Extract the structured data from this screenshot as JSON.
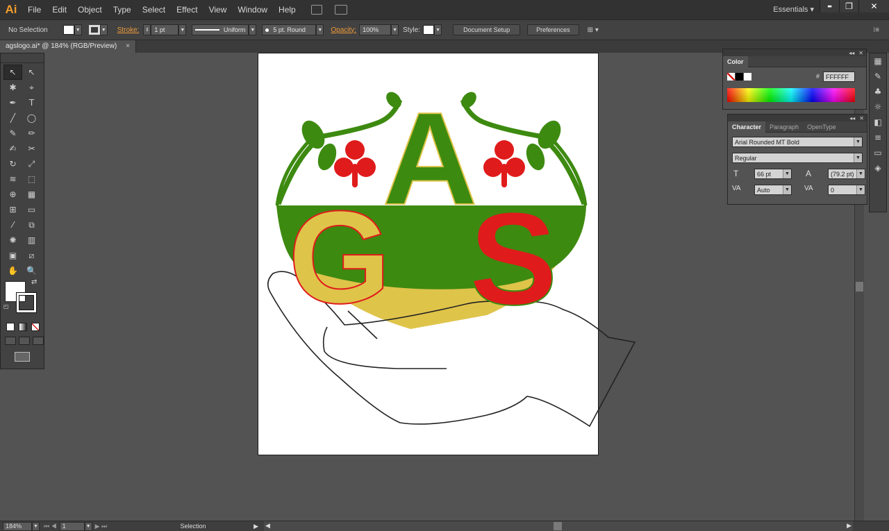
{
  "app": {
    "logo": "Ai"
  },
  "menu": [
    "File",
    "Edit",
    "Object",
    "Type",
    "Select",
    "Effect",
    "View",
    "Window",
    "Help"
  ],
  "workspace": "Essentials",
  "window_controls": {
    "minimize": "▬",
    "restore": "❐",
    "close": "✕"
  },
  "control_bar": {
    "selection": "No Selection",
    "stroke_label": "Stroke:",
    "stroke_value": "1 pt",
    "profile": "Uniform",
    "brush": "5 pt. Round",
    "opacity_label": "Opacity:",
    "opacity_value": "100%",
    "style_label": "Style:",
    "document_setup": "Document Setup",
    "preferences": "Preferences"
  },
  "document_tab": {
    "title": "agslogo.ai* @ 184% (RGB/Preview)",
    "close": "×"
  },
  "toolbox": {
    "tools": [
      [
        "selection-tool",
        "direct-selection-tool"
      ],
      [
        "magic-wand-tool",
        "lasso-tool"
      ],
      [
        "pen-tool",
        "type-tool"
      ],
      [
        "line-tool",
        "ellipse-tool"
      ],
      [
        "paintbrush-tool",
        "pencil-tool"
      ],
      [
        "blob-brush-tool",
        "scissors-tool"
      ],
      [
        "rotate-tool",
        "scale-tool"
      ],
      [
        "width-tool",
        "free-transform-tool"
      ],
      [
        "shape-builder-tool",
        "perspective-grid-tool"
      ],
      [
        "mesh-tool",
        "gradient-tool"
      ],
      [
        "eyedropper-tool",
        "blend-tool"
      ],
      [
        "symbol-sprayer-tool",
        "column-graph-tool"
      ],
      [
        "artboard-tool",
        "slice-tool"
      ],
      [
        "hand-tool",
        "zoom-tool"
      ]
    ],
    "glyphs": [
      [
        "↖",
        "↖"
      ],
      [
        "✱",
        "⌖"
      ],
      [
        "✒",
        "T"
      ],
      [
        "╱",
        "◯"
      ],
      [
        "✎",
        "✏"
      ],
      [
        "✍",
        "✂"
      ],
      [
        "↻",
        "⤢"
      ],
      [
        "≋",
        "⬚"
      ],
      [
        "⊕",
        "▦"
      ],
      [
        "⊞",
        "▭"
      ],
      [
        "⁄",
        "⧉"
      ],
      [
        "✺",
        "▥"
      ],
      [
        "▣",
        "⧄"
      ],
      [
        "✋",
        "🔍"
      ]
    ]
  },
  "color_panel": {
    "title": "Color",
    "hex_label": "#",
    "hex_value": "FFFFFF"
  },
  "character_panel": {
    "tabs": [
      "Character",
      "Paragraph",
      "OpenType"
    ],
    "font_family": "Arial Rounded MT Bold",
    "font_style": "Regular",
    "font_size": "66 pt",
    "leading": "(79.2 pt)",
    "kerning": "Auto",
    "tracking": "0",
    "size_icon": "T",
    "leading_icon": "A",
    "kerning_icon": "VA",
    "tracking_icon": "VA"
  },
  "status_bar": {
    "zoom": "184%",
    "artboard_number": "1",
    "current_tool": "Selection"
  },
  "artwork": {
    "letters": [
      "A",
      "G",
      "S"
    ],
    "colors": {
      "green": "#3d8a10",
      "yellow": "#dfc44a",
      "red": "#e01b1b",
      "outline": "#222222"
    }
  }
}
